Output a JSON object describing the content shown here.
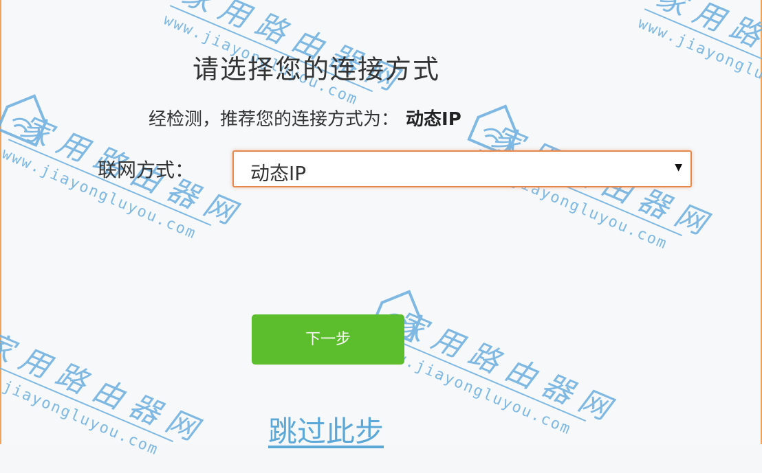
{
  "page": {
    "title": "请选择您的连接方式",
    "recommend_prefix": "经检测，推荐您的连接方式为：",
    "recommend_value": "动态IP"
  },
  "form": {
    "connection_label": "联网方式：",
    "connection_select": {
      "selected": "动态IP"
    }
  },
  "actions": {
    "next_label": "下一步",
    "skip_label": "跳过此步"
  },
  "watermark": {
    "brand": "家用路由器网",
    "url": "www.jiayongluyou.com"
  },
  "colors": {
    "primary_button": "#5cbd2d",
    "select_border": "#e8874a",
    "link": "#5aa7d8",
    "watermark": "#6aaee0",
    "frame_border": "#f0a35a"
  },
  "icons": {
    "select_caret": "caret-down-icon",
    "watermark_house": "house-wifi-icon"
  }
}
